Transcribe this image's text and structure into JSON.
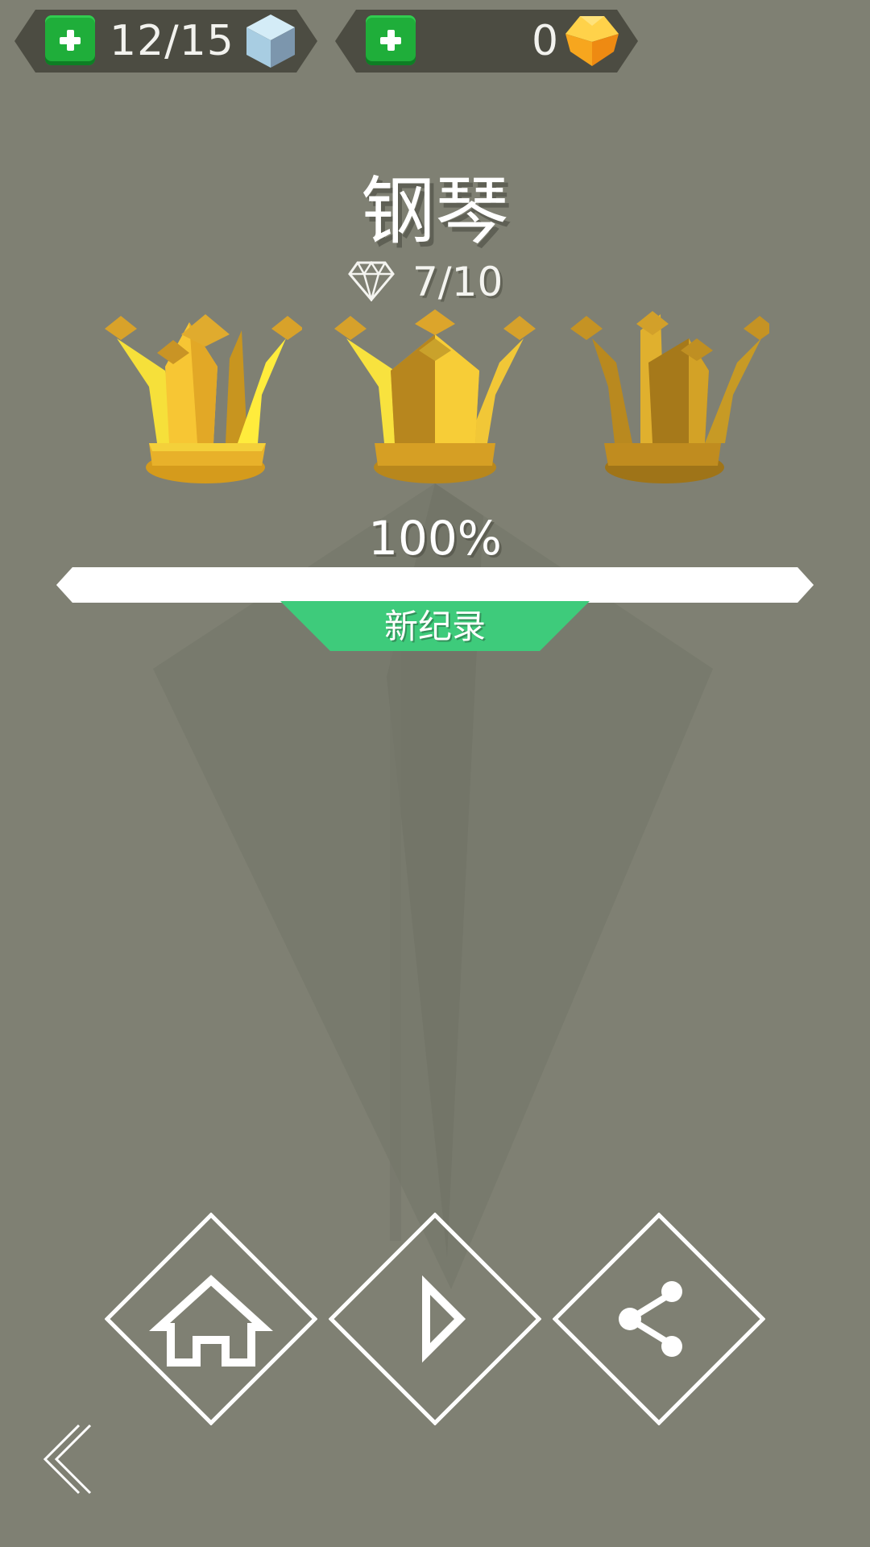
{
  "top_bar": {
    "cubes": {
      "value": "12/15",
      "icon": "ice-cube-icon",
      "add_icon": "plus-icon"
    },
    "gems": {
      "value": "0",
      "icon": "gold-gem-icon",
      "add_icon": "plus-icon"
    }
  },
  "level": {
    "title": "钢琴",
    "diamonds": "7/10",
    "diamond_icon": "diamond-icon",
    "crowns_earned": 3,
    "crowns_total": 3,
    "progress": 1.0,
    "percent_label": "100%",
    "record_label": "新纪录"
  },
  "actions": {
    "home_icon": "home-icon",
    "play_icon": "play-icon",
    "share_icon": "share-icon",
    "back_icon": "back-arrow-icon"
  },
  "colors": {
    "background": "#7f8073",
    "record_badge": "#3ecb7b",
    "plus_button": "#1fae3a",
    "crown_gold": "#f2c232"
  }
}
